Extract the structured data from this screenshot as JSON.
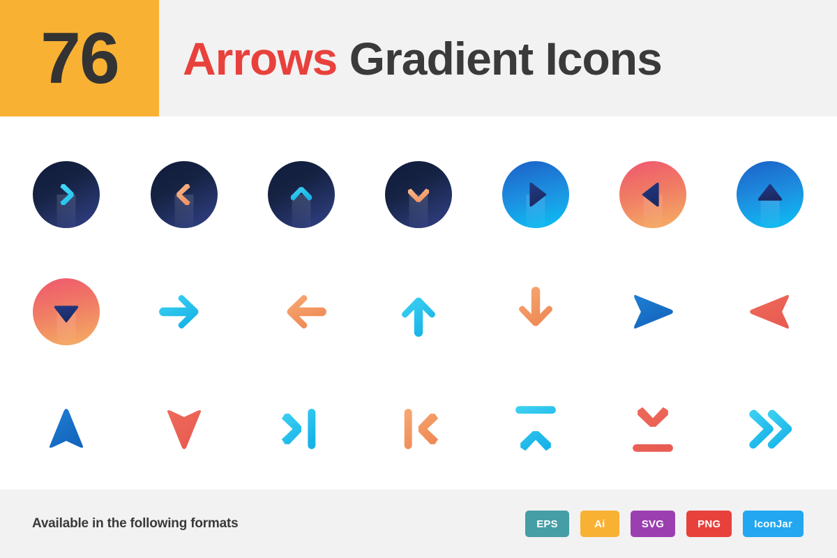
{
  "header": {
    "count": "76",
    "title_keyword": "Arrows",
    "title_rest": "Gradient Icons",
    "count_bg_color": "#f8b133",
    "keyword_color": "#e8413c",
    "rest_color": "#3a3a3a",
    "bg_color": "#f2f2f2"
  },
  "footer": {
    "label": "Available in the following formats",
    "bg_color": "#f2f2f2",
    "badges": [
      {
        "label": "EPS",
        "color": "#459da5"
      },
      {
        "label": "Ai",
        "color": "#f8b133"
      },
      {
        "label": "SVG",
        "color": "#9b3fb0"
      },
      {
        "label": "PNG",
        "color": "#e8413c"
      },
      {
        "label": "IconJar",
        "color": "#22a7f0"
      }
    ]
  },
  "palette": {
    "navy_dark": "#0f1a38",
    "navy_mid": "#1b2a5e",
    "indigo": "#23316e",
    "cyan_light": "#3fd2f2",
    "cyan": "#22b6ea",
    "blue": "#1477d1",
    "blue_deep": "#1d2f6f",
    "orange_light": "#f7b183",
    "orange": "#f08a53",
    "coral": "#ee6a5a",
    "red": "#ef5350",
    "pink": "#ef5a6e"
  },
  "grid": {
    "columns": 7,
    "rows": 3,
    "total_icons": 21,
    "icons": [
      {
        "name": "chevron-right-circle-icon",
        "row": 1,
        "col": 1,
        "style": "circle-dark",
        "glyph": "chevron-right",
        "color": "cyan_light"
      },
      {
        "name": "chevron-left-circle-icon",
        "row": 1,
        "col": 2,
        "style": "circle-dark",
        "glyph": "chevron-left",
        "color": "orange_light"
      },
      {
        "name": "chevron-up-circle-icon",
        "row": 1,
        "col": 3,
        "style": "circle-dark",
        "glyph": "chevron-up",
        "color": "cyan"
      },
      {
        "name": "chevron-down-circle-icon",
        "row": 1,
        "col": 4,
        "style": "circle-dark",
        "glyph": "chevron-down",
        "color": "orange_light"
      },
      {
        "name": "play-right-circle-icon",
        "row": 1,
        "col": 5,
        "style": "circle-blue",
        "glyph": "triangle-right",
        "color": "navy_mid"
      },
      {
        "name": "play-left-circle-icon",
        "row": 1,
        "col": 6,
        "style": "circle-coral",
        "glyph": "triangle-left",
        "color": "navy_mid"
      },
      {
        "name": "play-up-circle-icon",
        "row": 1,
        "col": 7,
        "style": "circle-blue",
        "glyph": "triangle-up",
        "color": "navy_mid"
      },
      {
        "name": "play-down-circle-icon",
        "row": 2,
        "col": 1,
        "style": "circle-coral",
        "glyph": "triangle-down",
        "color": "navy_mid"
      },
      {
        "name": "arrow-right-icon",
        "row": 2,
        "col": 2,
        "style": "plain",
        "glyph": "arrow-right",
        "color": "cyan"
      },
      {
        "name": "arrow-left-icon",
        "row": 2,
        "col": 3,
        "style": "plain",
        "glyph": "arrow-left",
        "color": "orange"
      },
      {
        "name": "arrow-up-icon",
        "row": 2,
        "col": 4,
        "style": "plain",
        "glyph": "arrow-up",
        "color": "cyan"
      },
      {
        "name": "arrow-down-icon",
        "row": 2,
        "col": 5,
        "style": "plain",
        "glyph": "arrow-down",
        "color": "orange"
      },
      {
        "name": "send-right-icon",
        "row": 2,
        "col": 6,
        "style": "plain",
        "glyph": "send-right",
        "color": "blue"
      },
      {
        "name": "send-left-icon",
        "row": 2,
        "col": 7,
        "style": "plain",
        "glyph": "send-left",
        "color": "coral"
      },
      {
        "name": "navigation-up-icon",
        "row": 3,
        "col": 1,
        "style": "plain",
        "glyph": "send-up",
        "color": "blue"
      },
      {
        "name": "navigation-down-icon",
        "row": 3,
        "col": 2,
        "style": "plain",
        "glyph": "send-down",
        "color": "coral"
      },
      {
        "name": "skip-forward-icon",
        "row": 3,
        "col": 3,
        "style": "plain",
        "glyph": "skip-right",
        "color": "cyan"
      },
      {
        "name": "skip-back-icon",
        "row": 3,
        "col": 4,
        "style": "plain",
        "glyph": "skip-left",
        "color": "orange"
      },
      {
        "name": "skip-to-top-icon",
        "row": 3,
        "col": 5,
        "style": "plain",
        "glyph": "skip-up",
        "color": "cyan"
      },
      {
        "name": "skip-to-bottom-icon",
        "row": 3,
        "col": 6,
        "style": "plain",
        "glyph": "skip-down",
        "color": "coral"
      },
      {
        "name": "double-chevron-right-icon",
        "row": 3,
        "col": 7,
        "style": "plain",
        "glyph": "double-chevron-right",
        "color": "cyan"
      }
    ]
  }
}
